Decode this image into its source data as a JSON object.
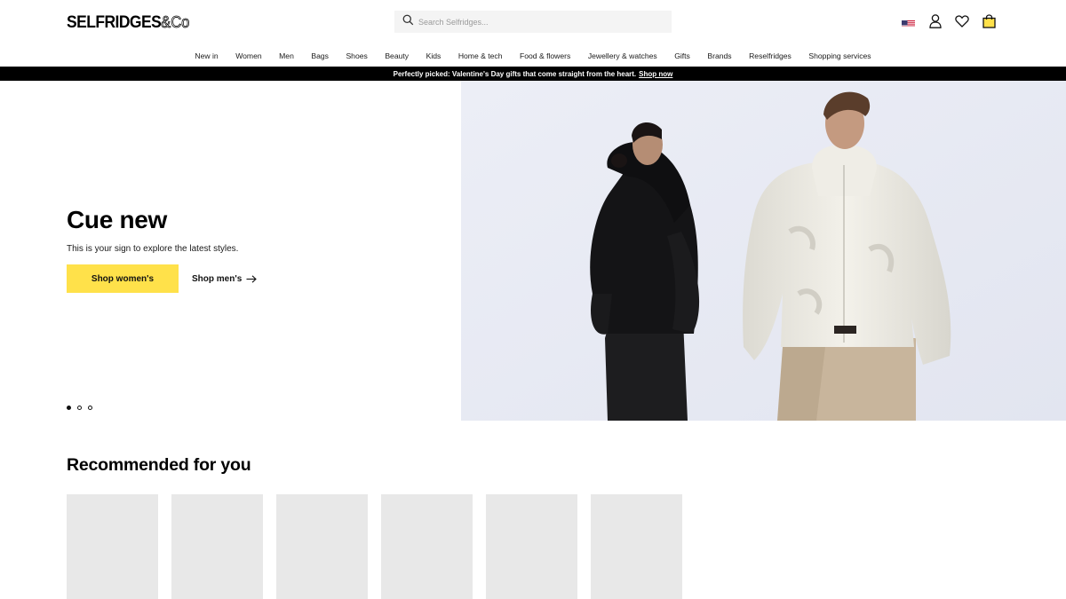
{
  "header": {
    "logo_text": "SELFRIDGES",
    "logo_amp": "&Co",
    "search_placeholder": "Search Selfridges..."
  },
  "nav": {
    "items": [
      "New in",
      "Women",
      "Men",
      "Bags",
      "Shoes",
      "Beauty",
      "Kids",
      "Home & tech",
      "Food & flowers",
      "Jewellery & watches",
      "Gifts",
      "Brands",
      "Reselfridges",
      "Shopping services"
    ]
  },
  "promo": {
    "text": "Perfectly picked: Valentine's Day gifts that come straight from the heart.",
    "link": "Shop now"
  },
  "hero": {
    "title": "Cue new",
    "subtitle": "This is your sign to explore the latest styles.",
    "primary_cta": "Shop women's",
    "secondary_cta": "Shop men's",
    "slide_count": 3,
    "active_slide": 1
  },
  "recommended": {
    "title": "Recommended for you",
    "card_count": 6
  },
  "colors": {
    "accent_yellow": "#ffe14a",
    "promo_bg": "#000000",
    "placeholder_gray": "#e8e8e8",
    "hero_bg": "#e9ebf4"
  }
}
